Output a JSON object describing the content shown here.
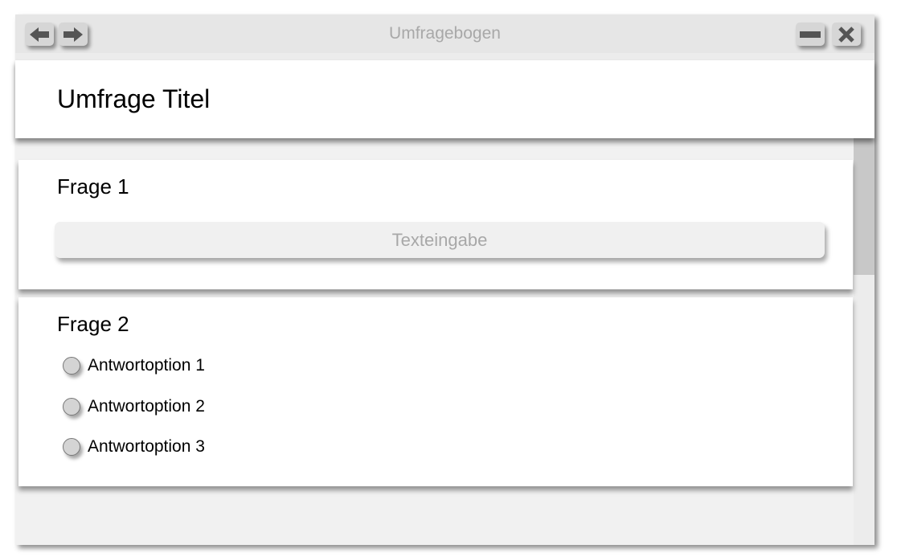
{
  "window": {
    "title": "Umfragebogen"
  },
  "header": {
    "title": "Umfrage Titel"
  },
  "questions": [
    {
      "label": "Frage 1",
      "input_placeholder": "Texteingabe"
    },
    {
      "label": "Frage 2",
      "options": [
        "Antwortoption 1",
        "Antwortoption 2",
        "Antwortoption 3"
      ]
    }
  ]
}
